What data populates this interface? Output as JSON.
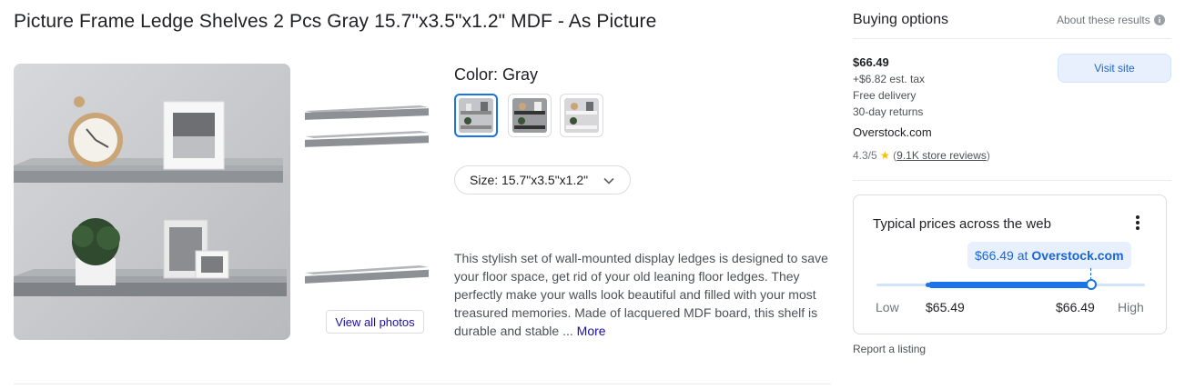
{
  "product": {
    "title": "Picture Frame Ledge Shelves 2 Pcs Gray 15.7\"x3.5\"x1.2\" MDF - As Picture",
    "color_label": "Color: Gray",
    "size_label": "Size: 15.7\"x3.5\"x1.2\"",
    "view_all_photos": "View all photos",
    "description": "This stylish set of wall-mounted display ledges is designed to save your floor space, get rid of your old leaning floor ledges. They perfectly make your walls look beautiful and filled with your most treasured memories. Made of lacquered MDF board, this shelf is durable and stable ...",
    "more_label": "More"
  },
  "buying": {
    "title": "Buying options",
    "about": "About these results",
    "price": "$66.49",
    "tax": "+$6.82 est. tax",
    "delivery": "Free delivery",
    "returns": "30-day returns",
    "store": "Overstock.com",
    "rating": "4.3/5",
    "reviews": "9.1K store reviews",
    "visit_label": "Visit site",
    "report": "Report a listing"
  },
  "typical": {
    "title": "Typical prices across the web",
    "bubble_price": "$66.49 at",
    "bubble_store": "Overstock.com",
    "low_label": "Low",
    "high_label": "High",
    "min_price": "$65.49",
    "max_price": "$66.49"
  },
  "colors": {
    "accent": "#1a73e8",
    "link": "#1a0dab",
    "chip_bg": "#e8f0fe",
    "star": "#fbbc04"
  }
}
